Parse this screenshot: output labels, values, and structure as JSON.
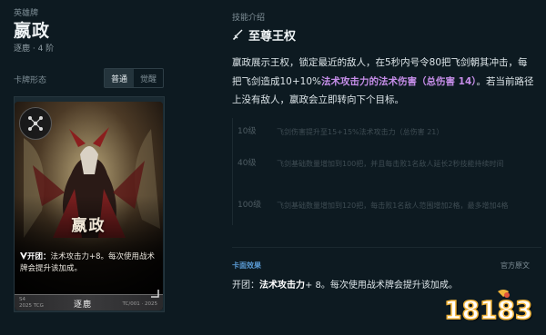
{
  "hero": {
    "category": "英雄牌",
    "name": "嬴政",
    "subtitle": "逐鹿 · 4 阶"
  },
  "card_form": {
    "label": "卡牌形态",
    "options": [
      "普通",
      "觉醒"
    ],
    "selected": "普通"
  },
  "card": {
    "title": "嬴政",
    "text_prefix": "开团：",
    "text_body": "法术攻击力+8。每次使用战术牌会提升该加成。",
    "bottom_left_line1": "S4",
    "bottom_left_line2": "2025 TCG",
    "bottom_center": "逐鹿",
    "bottom_right": "TC/001 · 2025"
  },
  "skill": {
    "intro_label": "技能介绍",
    "name": "至尊王权",
    "desc_part1": "嬴政展示王权，锁定最近的敌人，在5秒内号令80把飞剑朝其冲击，每把飞剑造成10+10%",
    "desc_highlight": "法术攻击力的法术伤害（总伤害 14）",
    "desc_part2": "。若当前路径上没有敌人，嬴政会立即转向下个目标。",
    "levels": [
      {
        "level": "10级",
        "text": "飞剑伤害提升至15+15%法术攻击力（总伤害 21）"
      },
      {
        "level": "40级",
        "text": "飞剑基础数量增加到100把，并且每击败1名敌人延长2秒技能持续时间"
      },
      {
        "level": "100级",
        "text": "飞剑基础数量增加到120把，每击败1名敌人范围增加2格，最多增加4格"
      }
    ]
  },
  "card_effect": {
    "label": "卡面效果",
    "official_label": "官方原文",
    "prefix": "开团：",
    "bold": "法术攻击力",
    "rest": "+ 8。每次使用战术牌会提升该加成。"
  },
  "watermark": {
    "text": "18183"
  },
  "colors": {
    "background": "#0d1a21",
    "highlight_purple": "#c58de8",
    "effect_label_blue": "#5a9bd4",
    "logo_gold": "#f0b43a"
  }
}
